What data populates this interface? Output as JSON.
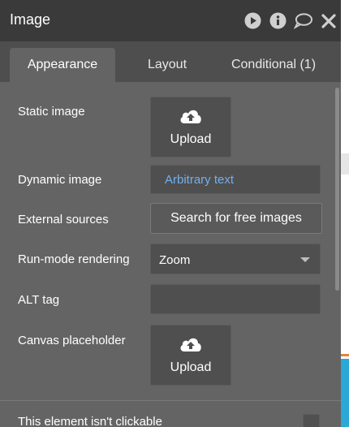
{
  "title": "Image",
  "tabs": [
    {
      "label": "Appearance",
      "active": true
    },
    {
      "label": "Layout",
      "active": false
    },
    {
      "label": "Conditional (1)",
      "active": false
    }
  ],
  "fields": {
    "static_image": {
      "label": "Static image",
      "button_label": "Upload",
      "icon": "cloud-upload-icon"
    },
    "dynamic_image": {
      "label": "Dynamic image",
      "value": "Arbitrary text"
    },
    "external_sources": {
      "label": "External sources",
      "button_label": "Search for free images"
    },
    "run_mode_rendering": {
      "label": "Run-mode rendering",
      "value": "Zoom"
    },
    "alt_tag": {
      "label": "ALT tag",
      "value": ""
    },
    "canvas_placeholder": {
      "label": "Canvas placeholder",
      "button_label": "Upload",
      "icon": "cloud-upload-icon"
    },
    "not_clickable": {
      "label": "This element isn't clickable",
      "checked": false
    }
  },
  "side_help": {
    "label": "?"
  },
  "titlebar_icons": [
    "play-icon",
    "info-icon",
    "comment-icon",
    "close-icon"
  ],
  "colors": {
    "panel": "#646464",
    "titlebar": "#3a3a3a",
    "tabs_bg": "#4e4e4e",
    "field": "#4f4f4f",
    "link_text": "#6fb0f0",
    "accent_orange": "#e4843c",
    "accent_blue": "#2aa8d8"
  }
}
